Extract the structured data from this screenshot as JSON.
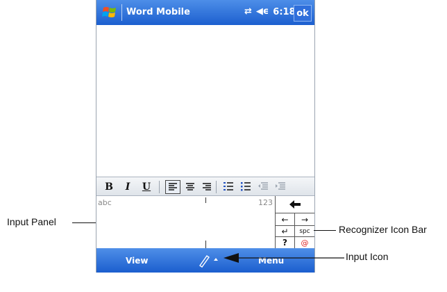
{
  "titlebar": {
    "app_title": "Word Mobile",
    "time": "6:18",
    "ok_label": "ok",
    "icons": [
      "windows-start-icon",
      "connectivity-icon",
      "volume-icon"
    ]
  },
  "toolbar": {
    "bold": "B",
    "italic": "I",
    "underline": "U",
    "buttons": [
      "bold",
      "italic",
      "underline",
      "align-left",
      "align-center",
      "align-right",
      "numbered-list",
      "bulleted-list",
      "outdent",
      "indent"
    ]
  },
  "input_panel": {
    "left_label": "abc",
    "right_label": "123"
  },
  "recognizer_bar": {
    "backspace": "🡐",
    "left_arrow": "←",
    "right_arrow": "→",
    "enter": "↵",
    "space": "spc",
    "question": "?",
    "symbols": "@"
  },
  "menubar": {
    "left": "View",
    "right": "Menu"
  },
  "callouts": {
    "input_panel": "Input Panel",
    "recognizer_icon_bar": "Recognizer Icon Bar",
    "input_icon": "Input Icon"
  },
  "colors": {
    "title_bar": "#2a6fdc",
    "menu_bar": "#2a6fdc",
    "toolbar_bg": "#e6eaef"
  }
}
